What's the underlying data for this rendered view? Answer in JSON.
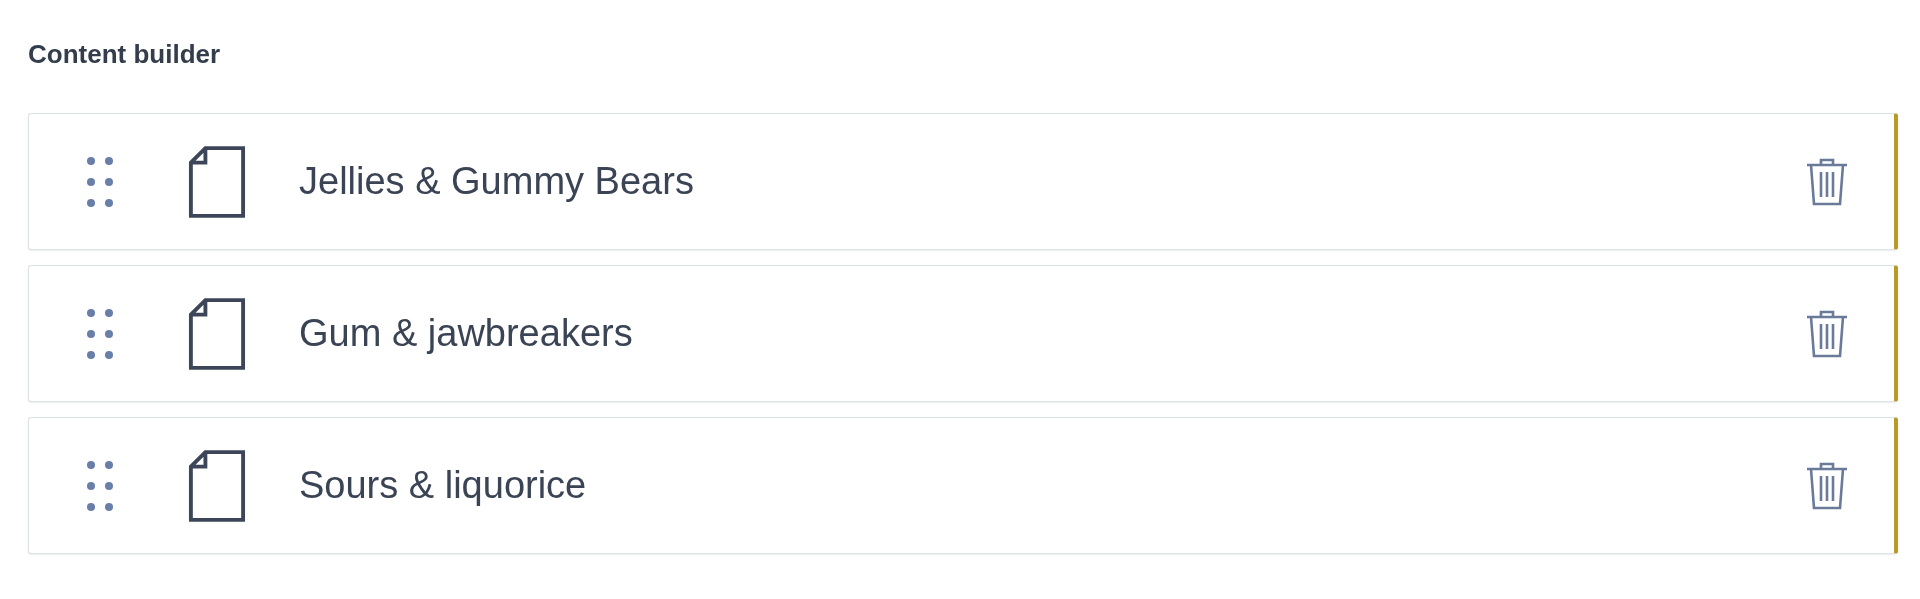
{
  "section": {
    "title": "Content builder"
  },
  "items": [
    {
      "label": "Jellies & Gummy Bears"
    },
    {
      "label": "Gum & jawbreakers"
    },
    {
      "label": "Sours & liquorice"
    }
  ]
}
